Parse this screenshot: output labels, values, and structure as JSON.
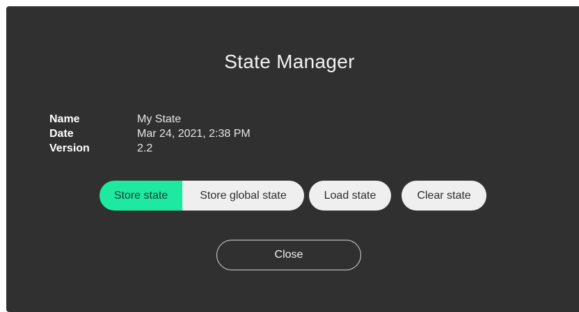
{
  "dialog": {
    "title": "State Manager",
    "info": [
      {
        "key": "Name",
        "value": "My State"
      },
      {
        "key": "Date",
        "value": "Mar 24, 2021, 2:38 PM"
      },
      {
        "key": "Version",
        "value": "2.2"
      }
    ],
    "buttons": {
      "store_state": "Store state",
      "store_global_state": "Store global state",
      "load_state": "Load state",
      "clear_state": "Clear state",
      "close": "Close"
    },
    "colors": {
      "background": "#303030",
      "accent": "#1de9a0",
      "button_bg": "#efefef"
    }
  }
}
